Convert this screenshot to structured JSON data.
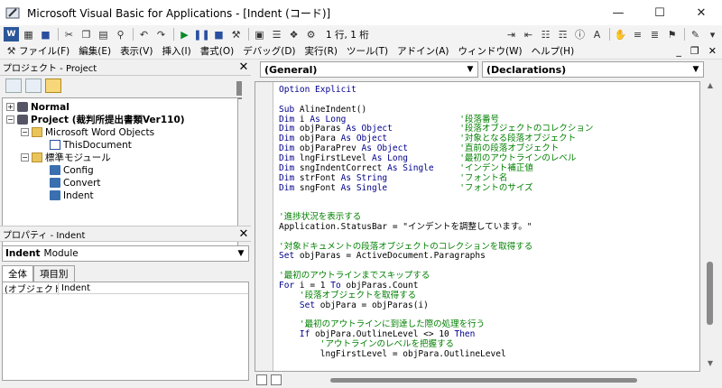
{
  "window": {
    "title": "Microsoft Visual Basic for Applications - [Indent (コード)]",
    "minimize": "—",
    "maximize": "☐",
    "close": "✕"
  },
  "toolbar": {
    "position_label": "1 行, 1 桁"
  },
  "menu": {
    "items": [
      "ファイル(F)",
      "編集(E)",
      "表示(V)",
      "挿入(I)",
      "書式(O)",
      "デバッグ(D)",
      "実行(R)",
      "ツール(T)",
      "アドイン(A)",
      "ウィンドウ(W)",
      "ヘルプ(H)"
    ],
    "minimize": "_",
    "restore": "❐",
    "close": "✕"
  },
  "project": {
    "title": "プロジェクト - Project",
    "close": "✕",
    "tree": [
      {
        "label": "Normal",
        "bold": true,
        "toggle": "+",
        "icon": "project-icon"
      },
      {
        "label": "Project (裁判所提出書類Ver110)",
        "bold": true,
        "toggle": "−",
        "icon": "project-icon"
      },
      {
        "label": "Microsoft Word Objects",
        "toggle": "−",
        "icon": "folder-icon"
      },
      {
        "label": "ThisDocument",
        "icon": "document-icon"
      },
      {
        "label": "標準モジュール",
        "toggle": "−",
        "icon": "folder-icon"
      },
      {
        "label": "Config",
        "icon": "module-icon"
      },
      {
        "label": "Convert",
        "icon": "module-icon"
      },
      {
        "label": "Indent",
        "icon": "module-icon"
      }
    ]
  },
  "properties": {
    "title": "プロパティ - Indent",
    "close": "✕",
    "object_name": "Indent",
    "object_type": "Module",
    "tabs": [
      "全体",
      "項目別"
    ],
    "rows": [
      {
        "key": "(オブジェクト名)",
        "value": "Indent"
      }
    ]
  },
  "code": {
    "object_combo": "(General)",
    "proc_combo": "(Declarations)",
    "lines": [
      [
        {
          "t": "Option Explicit",
          "c": "kw"
        }
      ],
      [],
      [
        {
          "t": "Sub ",
          "c": "kw"
        },
        {
          "t": "AlineIndent()",
          "c": "tx"
        }
      ],
      [
        {
          "t": "Dim ",
          "c": "kw"
        },
        {
          "t": "i ",
          "c": "tx"
        },
        {
          "t": "As Long",
          "c": "kw"
        },
        {
          "t": "                      '段落番号",
          "c": "cm"
        }
      ],
      [
        {
          "t": "Dim ",
          "c": "kw"
        },
        {
          "t": "objParas ",
          "c": "tx"
        },
        {
          "t": "As Object",
          "c": "kw"
        },
        {
          "t": "             '段落オブジェクトのコレクション",
          "c": "cm"
        }
      ],
      [
        {
          "t": "Dim ",
          "c": "kw"
        },
        {
          "t": "objPara ",
          "c": "tx"
        },
        {
          "t": "As Object",
          "c": "kw"
        },
        {
          "t": "              '対象となる段落オブジェクト",
          "c": "cm"
        }
      ],
      [
        {
          "t": "Dim ",
          "c": "kw"
        },
        {
          "t": "objParaPrev ",
          "c": "tx"
        },
        {
          "t": "As Object",
          "c": "kw"
        },
        {
          "t": "          '直前の段落オブジェクト",
          "c": "cm"
        }
      ],
      [
        {
          "t": "Dim ",
          "c": "kw"
        },
        {
          "t": "lngFirstLevel ",
          "c": "tx"
        },
        {
          "t": "As Long",
          "c": "kw"
        },
        {
          "t": "          '最初のアウトラインのレベル",
          "c": "cm"
        }
      ],
      [
        {
          "t": "Dim ",
          "c": "kw"
        },
        {
          "t": "sngIndentCorrect ",
          "c": "tx"
        },
        {
          "t": "As Single",
          "c": "kw"
        },
        {
          "t": "     'インデント補正値",
          "c": "cm"
        }
      ],
      [
        {
          "t": "Dim ",
          "c": "kw"
        },
        {
          "t": "strFont ",
          "c": "tx"
        },
        {
          "t": "As String",
          "c": "kw"
        },
        {
          "t": "              'フォント名",
          "c": "cm"
        }
      ],
      [
        {
          "t": "Dim ",
          "c": "kw"
        },
        {
          "t": "sngFont ",
          "c": "tx"
        },
        {
          "t": "As Single",
          "c": "kw"
        },
        {
          "t": "              'フォントのサイズ",
          "c": "cm"
        }
      ],
      [],
      [],
      [
        {
          "t": "'進捗状況を表示する",
          "c": "cm"
        }
      ],
      [
        {
          "t": "Application.StatusBar = \"インデントを調整しています。\"",
          "c": "tx"
        }
      ],
      [],
      [
        {
          "t": "'対象ドキュメントの段落オブジェクトのコレクションを取得する",
          "c": "cm"
        }
      ],
      [
        {
          "t": "Set ",
          "c": "kw"
        },
        {
          "t": "objParas = ActiveDocument.Paragraphs",
          "c": "tx"
        }
      ],
      [],
      [
        {
          "t": "'最初のアウトラインまでスキップする",
          "c": "cm"
        }
      ],
      [
        {
          "t": "For ",
          "c": "kw"
        },
        {
          "t": "i = 1 ",
          "c": "tx"
        },
        {
          "t": "To ",
          "c": "kw"
        },
        {
          "t": "objParas.Count",
          "c": "tx"
        }
      ],
      [
        {
          "t": "    '段落オブジェクトを取得する",
          "c": "cm"
        }
      ],
      [
        {
          "t": "    Set ",
          "c": "kw"
        },
        {
          "t": "objPara = objParas(i)",
          "c": "tx"
        }
      ],
      [],
      [
        {
          "t": "    '最初のアウトラインに到達した際の処理を行う",
          "c": "cm"
        }
      ],
      [
        {
          "t": "    If ",
          "c": "kw"
        },
        {
          "t": "objPara.OutlineLevel <> 10 ",
          "c": "tx"
        },
        {
          "t": "Then",
          "c": "kw"
        }
      ],
      [
        {
          "t": "        'アウトラインのレベルを把握する",
          "c": "cm"
        }
      ],
      [
        {
          "t": "        lngFirstLevel = objPara.OutlineLevel",
          "c": "tx"
        }
      ]
    ]
  }
}
